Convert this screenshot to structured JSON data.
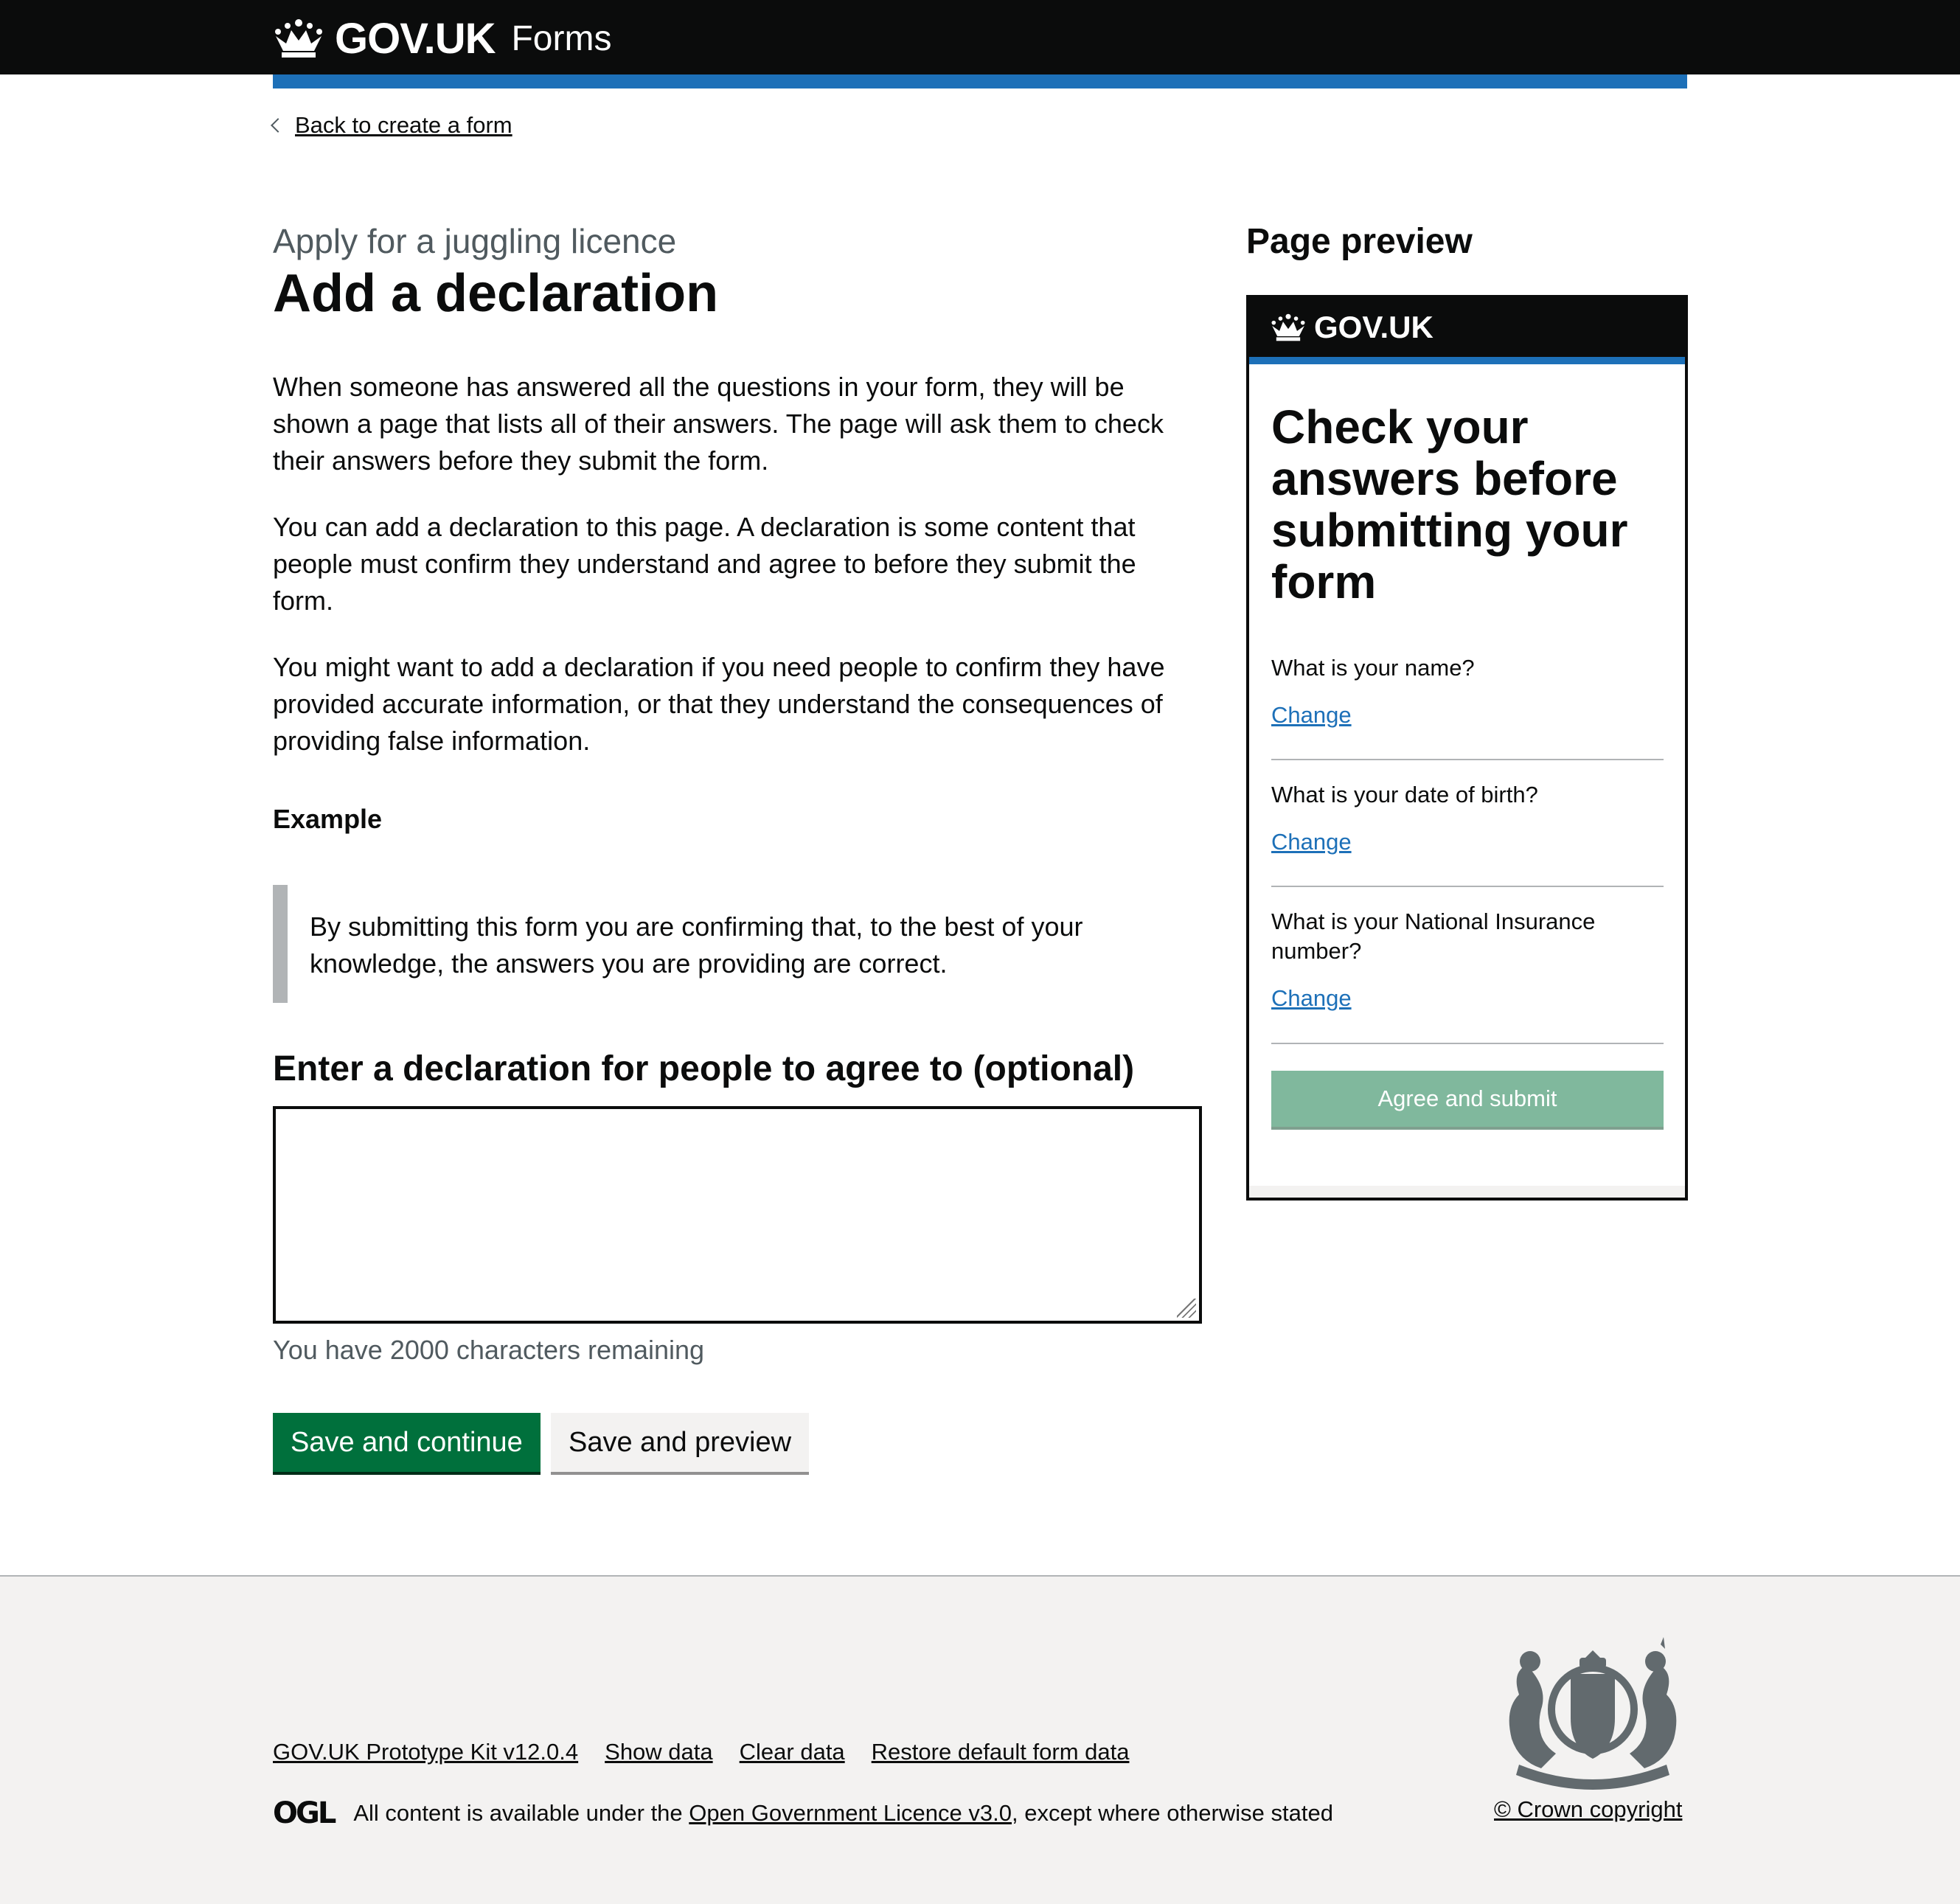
{
  "header": {
    "logo": "GOV.UK",
    "service": "Forms"
  },
  "back_link": "Back to create a form",
  "main": {
    "caption": "Apply for a juggling licence",
    "title": "Add a declaration",
    "paragraphs": [
      "When someone has answered all the questions in your form, they will be shown a page that lists all of their answers. The page will ask them to check their answers before they submit the form.",
      "You can add a declaration to this page. A declaration is some content that people must confirm they understand and agree to before they submit the form.",
      "You might want to add a declaration if you need people to confirm they have provided accurate information, or that they understand the consequences of providing false information."
    ],
    "example_heading": "Example",
    "example_text": "By submitting this form you are confirming that, to the best of your knowledge, the answers you are providing are correct.",
    "field_label": "Enter a declaration for people to agree to (optional)",
    "field_value": "",
    "char_count_hint": "You have 2000 characters remaining",
    "primary_button": "Save and continue",
    "secondary_button": "Save and preview"
  },
  "preview": {
    "heading": "Page preview",
    "logo": "GOV.UK",
    "title": "Check your answers before submitting your form",
    "rows": [
      {
        "question": "What is your name?",
        "action": "Change"
      },
      {
        "question": "What is your date of birth?",
        "action": "Change"
      },
      {
        "question": "What is your National Insurance number?",
        "action": "Change"
      }
    ],
    "submit_button": "Agree and submit"
  },
  "footer": {
    "links": [
      "GOV.UK Prototype Kit v12.0.4",
      "Show data",
      "Clear data",
      "Restore default form data"
    ],
    "ogl_logo": "OGL",
    "licence_prefix": "All content is available under the ",
    "licence_link": "Open Government Licence v3.0",
    "licence_suffix": ", except where otherwise stated",
    "copyright": "© Crown copyright"
  },
  "colors": {
    "header_bg": "#0b0c0c",
    "stripe": "#1d70b8",
    "primary_button": "#00703c",
    "preview_button": "#80b89d",
    "footer_bg": "#f3f2f1",
    "link": "#1d70b8"
  }
}
